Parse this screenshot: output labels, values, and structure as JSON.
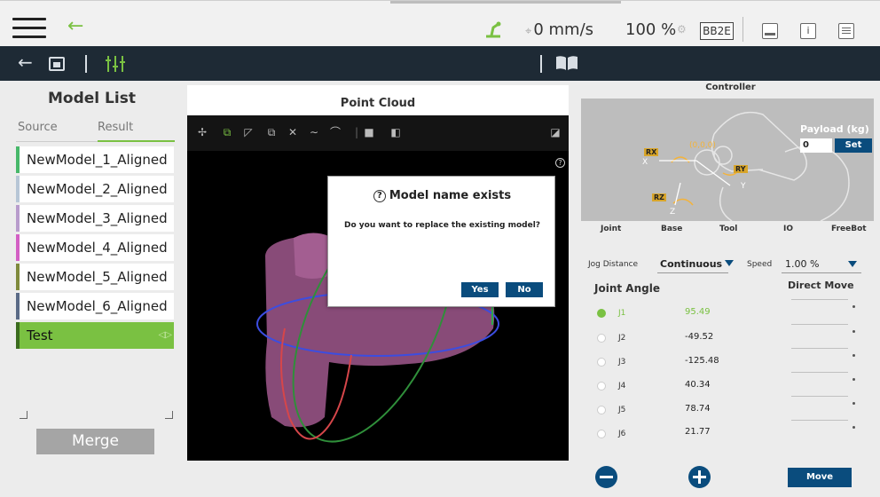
{
  "topbar": {
    "speed": "0 mm/s",
    "percent": "100 %",
    "badge": "BB2E",
    "info_glyph": "i"
  },
  "left_panel": {
    "title": "Model List",
    "tabs": [
      "Source",
      "Result"
    ],
    "models": [
      {
        "label": "NewModel_1_Aligned",
        "color": "#47b86a"
      },
      {
        "label": "NewModel_2_Aligned",
        "color": "#b7c6d6"
      },
      {
        "label": "NewModel_3_Aligned",
        "color": "#b89ccc"
      },
      {
        "label": "NewModel_4_Aligned",
        "color": "#d35fc4"
      },
      {
        "label": "NewModel_5_Aligned",
        "color": "#7f8a3c"
      },
      {
        "label": "NewModel_6_Aligned",
        "color": "#5a6a86"
      },
      {
        "label": "Test",
        "color": "#3b6b1e"
      }
    ],
    "merge_label": "Merge"
  },
  "point_cloud": {
    "title": "Point Cloud",
    "help_glyph": "?"
  },
  "dialog": {
    "title": "Model name exists",
    "message": "Do you want to replace the existing model?",
    "yes": "Yes",
    "no": "No"
  },
  "controller": {
    "title": "Controller",
    "payload_label": "Payload (kg)",
    "payload_value": "0",
    "set_label": "Set",
    "axes": {
      "rx": "RX",
      "ry": "RY",
      "rz": "RZ",
      "x": "X",
      "y": "Y",
      "z": "Z",
      "origin": "(0,0,0)"
    },
    "tabs": [
      "Joint",
      "Base",
      "Tool",
      "IO",
      "FreeBot"
    ],
    "jog_distance_label": "Jog Distance",
    "jog_distance_value": "Continuous",
    "speed_label": "Speed",
    "speed_value": "1.00 %",
    "joint_angle_label": "Joint Angle",
    "direct_move_label": "Direct Move",
    "joints": [
      {
        "name": "J1",
        "value": "95.49",
        "active": true
      },
      {
        "name": "J2",
        "value": "-49.52",
        "active": false
      },
      {
        "name": "J3",
        "value": "-125.48",
        "active": false
      },
      {
        "name": "J4",
        "value": "40.34",
        "active": false
      },
      {
        "name": "J5",
        "value": "78.74",
        "active": false
      },
      {
        "name": "J6",
        "value": "21.77",
        "active": false
      }
    ],
    "move_label": "Move"
  },
  "colors": {
    "accent_green": "#7ac142",
    "navy": "#0a4c7d",
    "navbar": "#1e2a35"
  }
}
